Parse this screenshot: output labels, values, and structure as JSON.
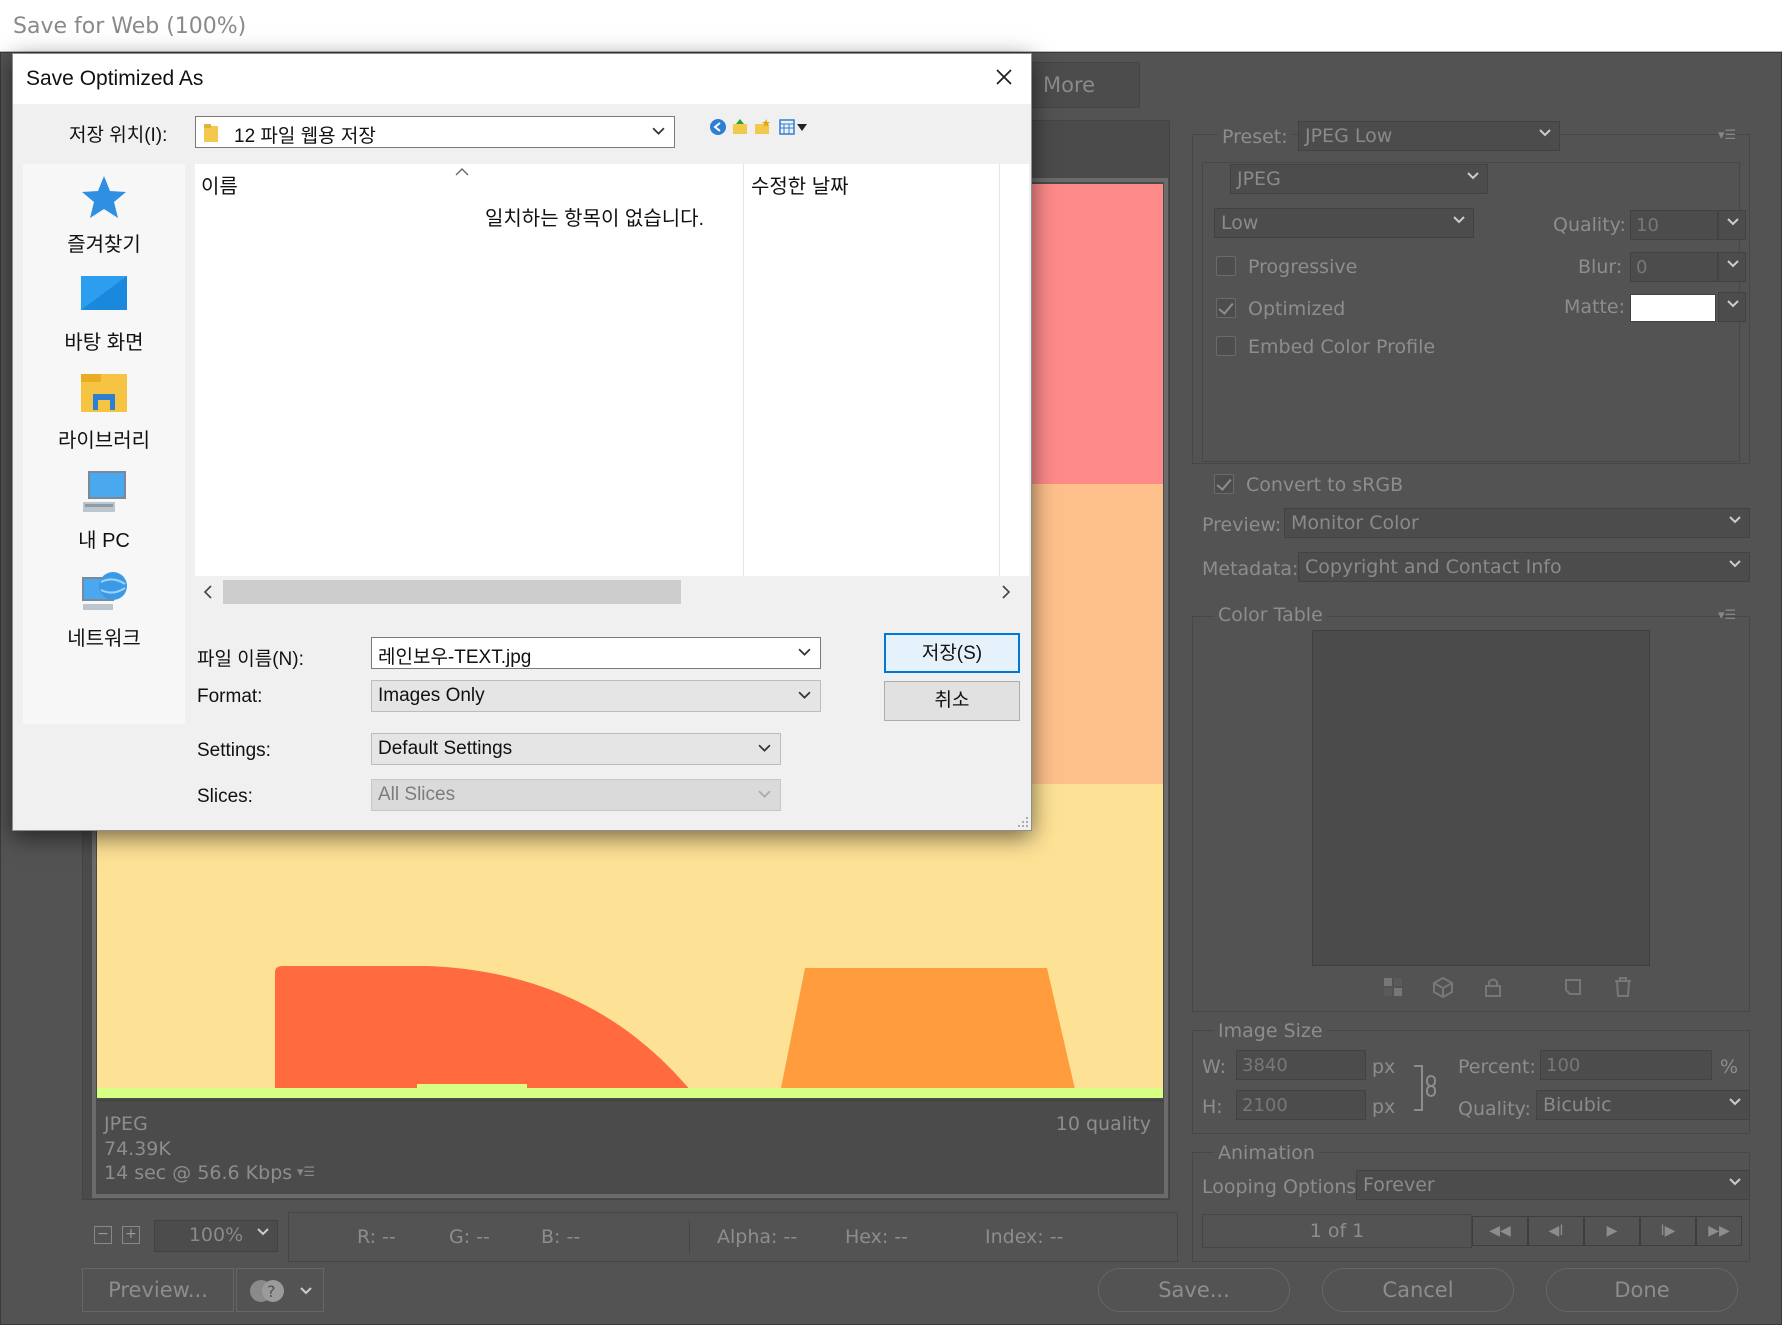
{
  "window": {
    "title": "Save for Web (100%)"
  },
  "tabs": {
    "more_label": "More"
  },
  "preview_info": {
    "format": "JPEG",
    "size": "74.39K",
    "time": "14 sec @ 56.6 Kbps",
    "quality": "10 quality"
  },
  "bottom_bar": {
    "zoom": "100%",
    "r": "R: --",
    "g": "G: --",
    "b": "B: --",
    "alpha": "Alpha: --",
    "hex": "Hex: --",
    "index": "Index: --",
    "preview_button": "Preview...",
    "save_button": "Save...",
    "cancel_button": "Cancel",
    "done_button": "Done"
  },
  "settings_panel": {
    "preset_label": "Preset:",
    "preset_value": "JPEG Low",
    "format_value": "JPEG",
    "compression_value": "Low",
    "quality_label": "Quality:",
    "quality_value": "10",
    "progressive_label": "Progressive",
    "blur_label": "Blur:",
    "blur_value": "0",
    "optimized_label": "Optimized",
    "matte_label": "Matte:",
    "matte_color": "#ffffff",
    "embed_label": "Embed Color Profile",
    "convert_label": "Convert to sRGB",
    "preview_label": "Preview:",
    "preview_value": "Monitor Color",
    "metadata_label": "Metadata:",
    "metadata_value": "Copyright and Contact Info"
  },
  "color_table": {
    "title": "Color Table"
  },
  "image_size": {
    "title": "Image Size",
    "w_label": "W:",
    "w_value": "3840",
    "h_label": "H:",
    "h_value": "2100",
    "px": "px",
    "percent_label": "Percent:",
    "percent_value": "100",
    "percent_unit": "%",
    "quality_label": "Quality:",
    "quality_value": "Bicubic"
  },
  "animation": {
    "title": "Animation",
    "looping_label": "Looping Options:",
    "looping_value": "Forever",
    "frame_counter": "1 of 1"
  },
  "dialog": {
    "title": "Save Optimized As",
    "location_label": "저장 위치(I):",
    "location_value": "12 파일 웹용 저장",
    "column_name": "이름",
    "column_date": "수정한 날짜",
    "empty_message": "일치하는 항목이 없습니다.",
    "nav_items": [
      "즐겨찾기",
      "바탕 화면",
      "라이브러리",
      "내 PC",
      "네트워크"
    ],
    "filename_label": "파일 이름(N):",
    "filename_value": "레인보우-TEXT.jpg",
    "format_label": "Format:",
    "format_value": "Images Only",
    "settings_label": "Settings:",
    "settings_value": "Default Settings",
    "slices_label": "Slices:",
    "slices_value": "All Slices",
    "save_button": "저장(S)",
    "cancel_button": "취소"
  },
  "colors": {
    "band_pink": "#ff8a8a",
    "band_peach": "#fec18b",
    "band_yellow": "#fde195",
    "letter_red": "#ff6a3f",
    "letter_orange": "#ff9d3e",
    "band_green": "#d6ff84",
    "accent_blue": "#0078d7"
  }
}
